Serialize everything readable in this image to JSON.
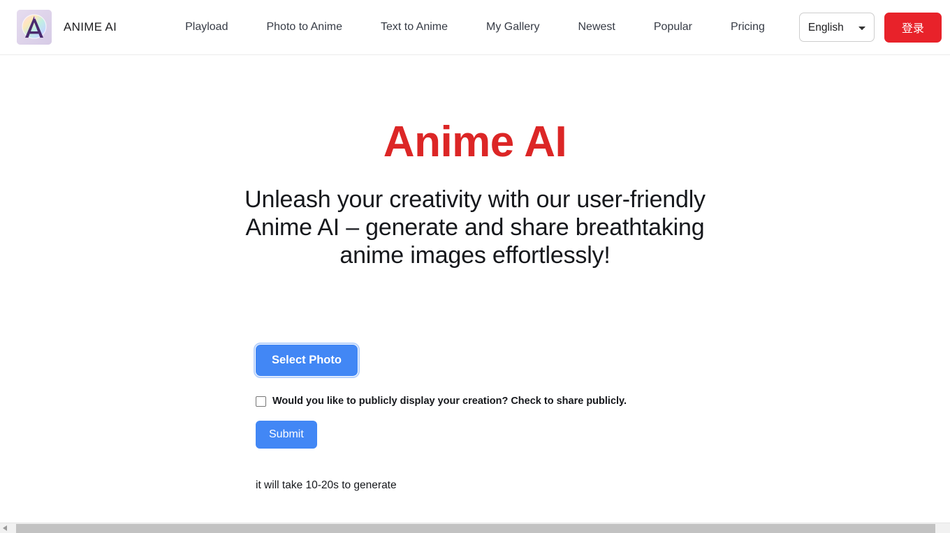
{
  "header": {
    "logo_icon": "anime-ai-logo-icon",
    "brand_name": "ANIME AI",
    "nav": [
      {
        "label": "Playload"
      },
      {
        "label": "Photo to Anime"
      },
      {
        "label": "Text to Anime"
      },
      {
        "label": "My Gallery"
      },
      {
        "label": "Newest"
      },
      {
        "label": "Popular"
      },
      {
        "label": "Pricing"
      }
    ],
    "language": {
      "selected": "English",
      "options": [
        "English"
      ],
      "chevron_icon": "chevron-down-icon"
    },
    "login_button": "登录"
  },
  "hero": {
    "title": "Anime AI",
    "subtitle": "Unleash your creativity with our user-friendly Anime AI – generate and share breathtaking anime images effortlessly!"
  },
  "form": {
    "select_photo_label": "Select Photo",
    "public_checkbox_label": "Would you like to publicly display your creation? Check to share publicly.",
    "public_checkbox_checked": false,
    "submit_label": "Submit",
    "hint": "it will take 10-20s to generate"
  },
  "scrollbar": {
    "left_arrow_icon": "triangle-left-icon"
  },
  "colors": {
    "accent_red": "#dc2626",
    "login_red": "#e8222a",
    "primary_blue": "#4287f5",
    "text_dark": "#16181c",
    "nav_text": "#363b45"
  }
}
